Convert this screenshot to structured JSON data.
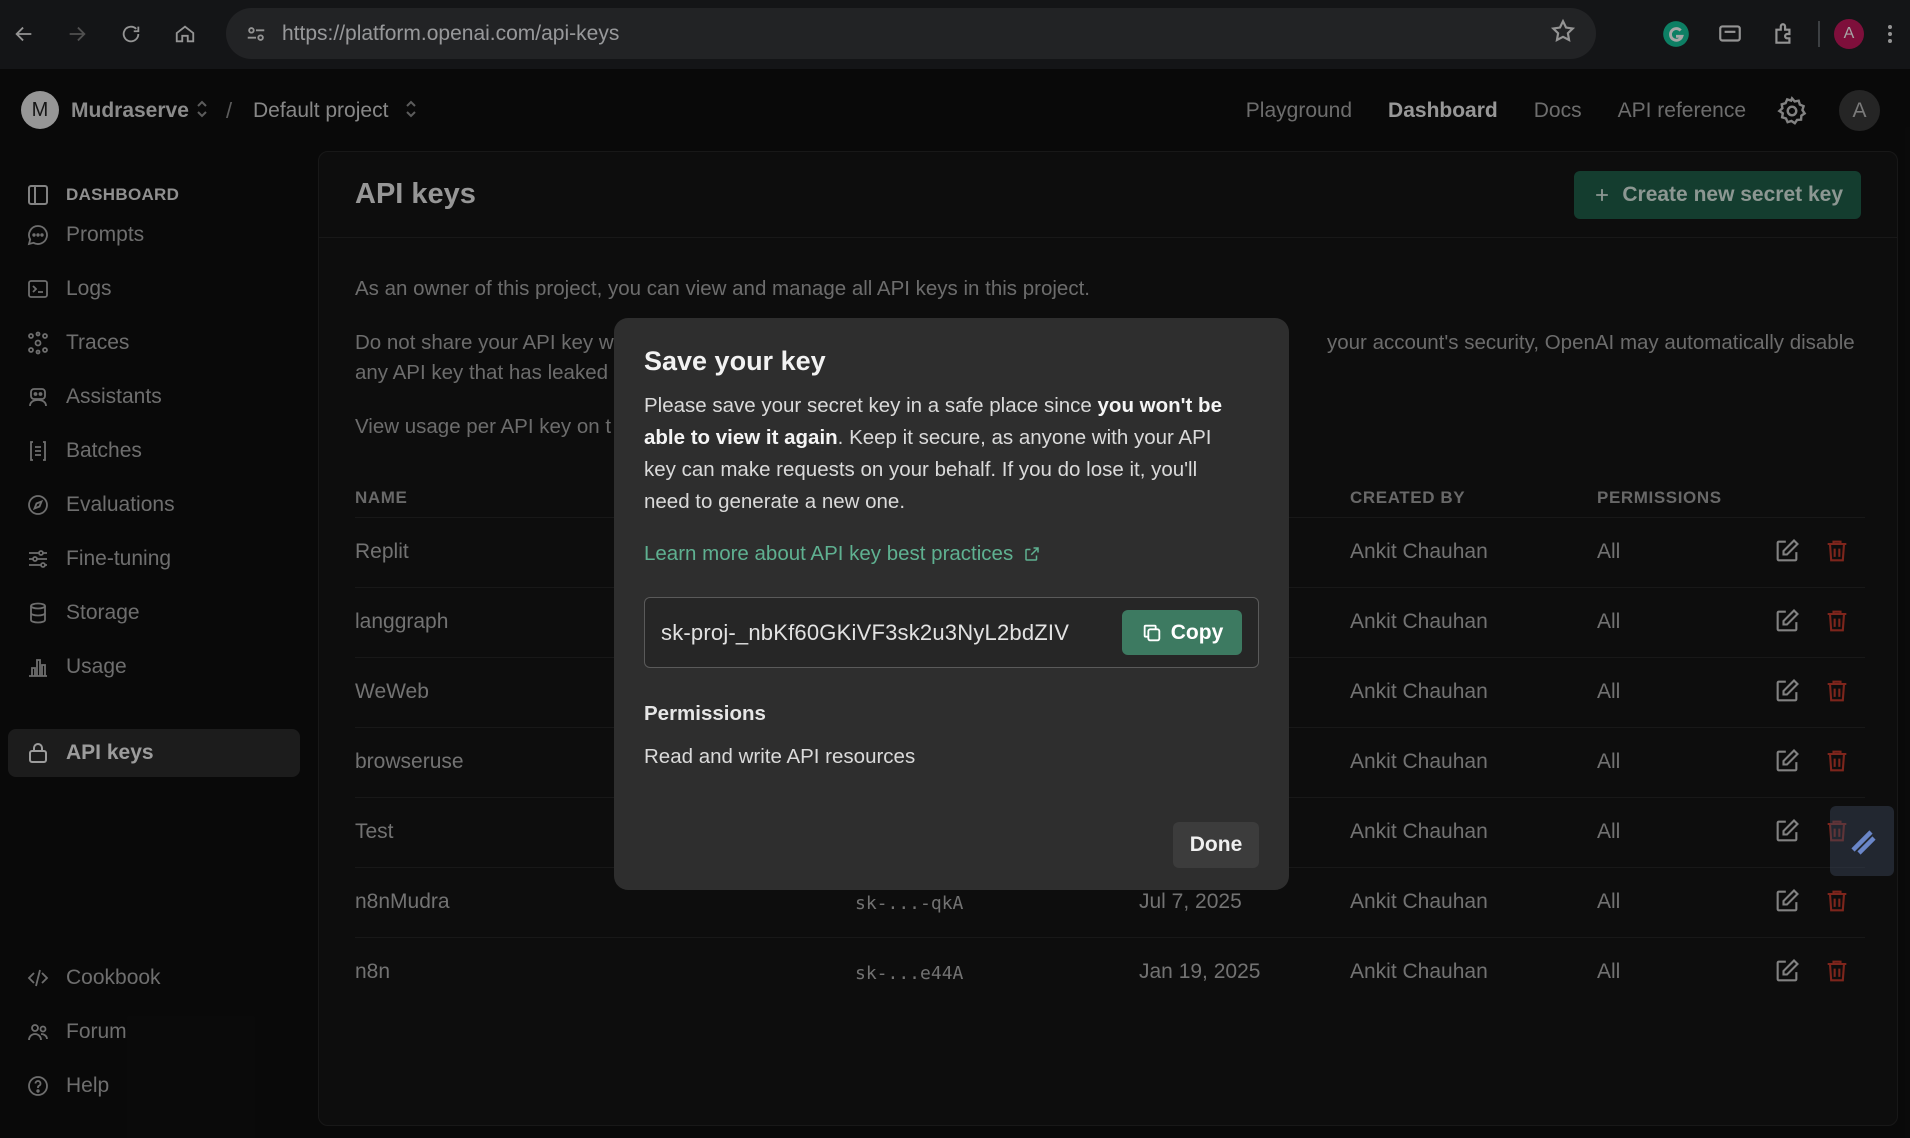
{
  "browser": {
    "url": "https://platform.openai.com/api-keys",
    "profile_initial": "A"
  },
  "appbar": {
    "org_initial": "M",
    "org_name": "Mudraserve",
    "separator": "/",
    "project_name": "Default project",
    "nav": [
      "Playground",
      "Dashboard",
      "Docs",
      "API reference"
    ],
    "active_nav": "Dashboard",
    "user_initial": "A"
  },
  "sidebar": {
    "heading": "DASHBOARD",
    "items": [
      {
        "label": "Prompts",
        "icon": "chat-bubble-icon"
      },
      {
        "label": "Logs",
        "icon": "terminal-icon"
      },
      {
        "label": "Traces",
        "icon": "traces-icon"
      },
      {
        "label": "Assistants",
        "icon": "robot-icon"
      },
      {
        "label": "Batches",
        "icon": "batches-icon"
      },
      {
        "label": "Evaluations",
        "icon": "compass-icon"
      },
      {
        "label": "Fine-tuning",
        "icon": "sliders-icon"
      },
      {
        "label": "Storage",
        "icon": "database-icon"
      },
      {
        "label": "Usage",
        "icon": "bar-chart-icon"
      },
      {
        "label": "API keys",
        "icon": "lock-icon"
      }
    ],
    "active": "API keys",
    "footer": [
      {
        "label": "Cookbook",
        "icon": "code-icon"
      },
      {
        "label": "Forum",
        "icon": "people-icon"
      },
      {
        "label": "Help",
        "icon": "help-icon"
      }
    ]
  },
  "main": {
    "title": "API keys",
    "create_label": "Create new secret key",
    "intro": "As an owner of this project, you can view and manage all API keys in this project.",
    "warning_left": "Do not share your API key w",
    "warning_right": "your account's security, OpenAI may automatically disable",
    "warning_line2": "any API key that has leaked",
    "usage_text": "View usage per API key on t",
    "columns": {
      "name": "NAME",
      "created_by": "CREATED BY",
      "permissions": "PERMISSIONS"
    },
    "rows": [
      {
        "name": "Replit",
        "secret": "",
        "created": "",
        "created_by": "Ankit Chauhan",
        "permissions": "All"
      },
      {
        "name": "langgraph",
        "secret": "",
        "created": "",
        "created_by": "Ankit Chauhan",
        "permissions": "All"
      },
      {
        "name": "WeWeb",
        "secret": "",
        "created": "",
        "created_by": "Ankit Chauhan",
        "permissions": "All"
      },
      {
        "name": "browseruse",
        "secret": "",
        "created": "",
        "created_by": "Ankit Chauhan",
        "permissions": "All"
      },
      {
        "name": "Test",
        "secret": "",
        "created": "",
        "created_by": "Ankit Chauhan",
        "permissions": "All"
      },
      {
        "name": "n8nMudra",
        "secret": "sk-...-qkA",
        "created": "Jul 7, 2025",
        "created_by": "Ankit Chauhan",
        "permissions": "All"
      },
      {
        "name": "n8n",
        "secret": "sk-...e44A",
        "created": "Jan 19, 2025",
        "created_by": "Ankit Chauhan",
        "permissions": "All"
      }
    ]
  },
  "modal": {
    "title": "Save your key",
    "body_1": "Please save your secret key in a safe place since ",
    "body_bold": "you won't be able to view it again",
    "body_2": ". Keep it secure, as anyone with your API key can make requests on your behalf. If you do lose it, you'll need to generate a new one.",
    "learn_more": "Learn more about API key best practices",
    "secret_key": "sk-proj-_nbKf60GKiVF3sk2u3NyL2bdZIV",
    "copy_label": "Copy",
    "permissions_title": "Permissions",
    "permissions_value": "Read and write API resources",
    "done_label": "Done"
  },
  "colors": {
    "accent_green": "#1f5e49",
    "copy_green": "#3d7a61",
    "link_green": "#5fb191",
    "delete_red": "#c0392b"
  }
}
